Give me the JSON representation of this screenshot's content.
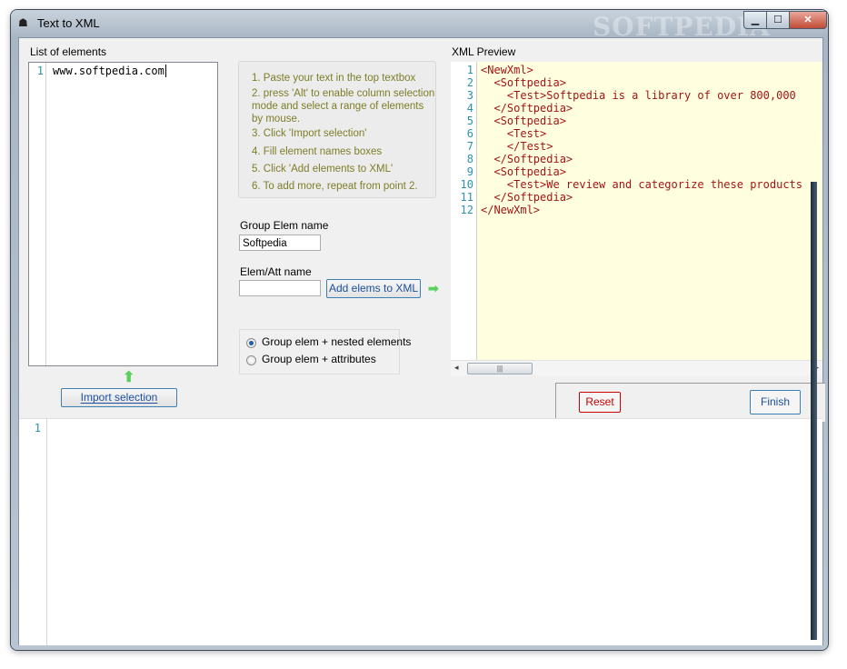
{
  "window": {
    "title": "Text to XML",
    "app_icon": "hat-icon",
    "watermark": "SOFTPEDIA",
    "controls": {
      "minimize": "▁",
      "maximize": "☐",
      "close": "✕"
    }
  },
  "elements_panel": {
    "label": "List of elements",
    "line_numbers": [
      "1"
    ],
    "lines": [
      "www.softpedia.com"
    ],
    "import_button": "Import selection"
  },
  "instructions": [
    "1. Paste your text in the top textbox",
    "2. press 'Alt' to enable column selection",
    "mode and select a range of elements",
    "by mouse.",
    "3. Click 'Import selection'",
    "4. Fill element names boxes",
    "5. Click 'Add elements to XML'",
    "6. To add more, repeat from point 2."
  ],
  "form": {
    "group_label": "Group Elem name",
    "group_value": "Softpedia",
    "elem_label": "Elem/Att name",
    "elem_value": "",
    "add_button": "Add elems to XML"
  },
  "mode_options": [
    {
      "label": "Group elem + nested elements",
      "checked": true
    },
    {
      "label": "Group elem + attributes",
      "checked": false
    }
  ],
  "preview": {
    "label": "XML Preview",
    "line_numbers": [
      "1",
      "2",
      "3",
      "4",
      "5",
      "6",
      "7",
      "8",
      "9",
      "10",
      "11",
      "12"
    ],
    "lines": [
      "<NewXml>",
      "  <Softpedia>",
      "    <Test>Softpedia is a library of over 800,000",
      "  </Softpedia>",
      "  <Softpedia>",
      "    <Test>",
      "    </Test>",
      "  </Softpedia>",
      "  <Softpedia>",
      "    <Test>We review and categorize these products",
      "  </Softpedia>",
      "</NewXml>"
    ]
  },
  "actions": {
    "reset": "Reset",
    "finish": "Finish"
  },
  "source_editor": {
    "line_numbers": [
      "1"
    ]
  },
  "colors": {
    "line_number": "#2b91af",
    "instructions": "#7d7d29",
    "preview_background": "#ffffe0",
    "reset_border": "#cc0000",
    "accent_arrow": "#5bd15b"
  }
}
